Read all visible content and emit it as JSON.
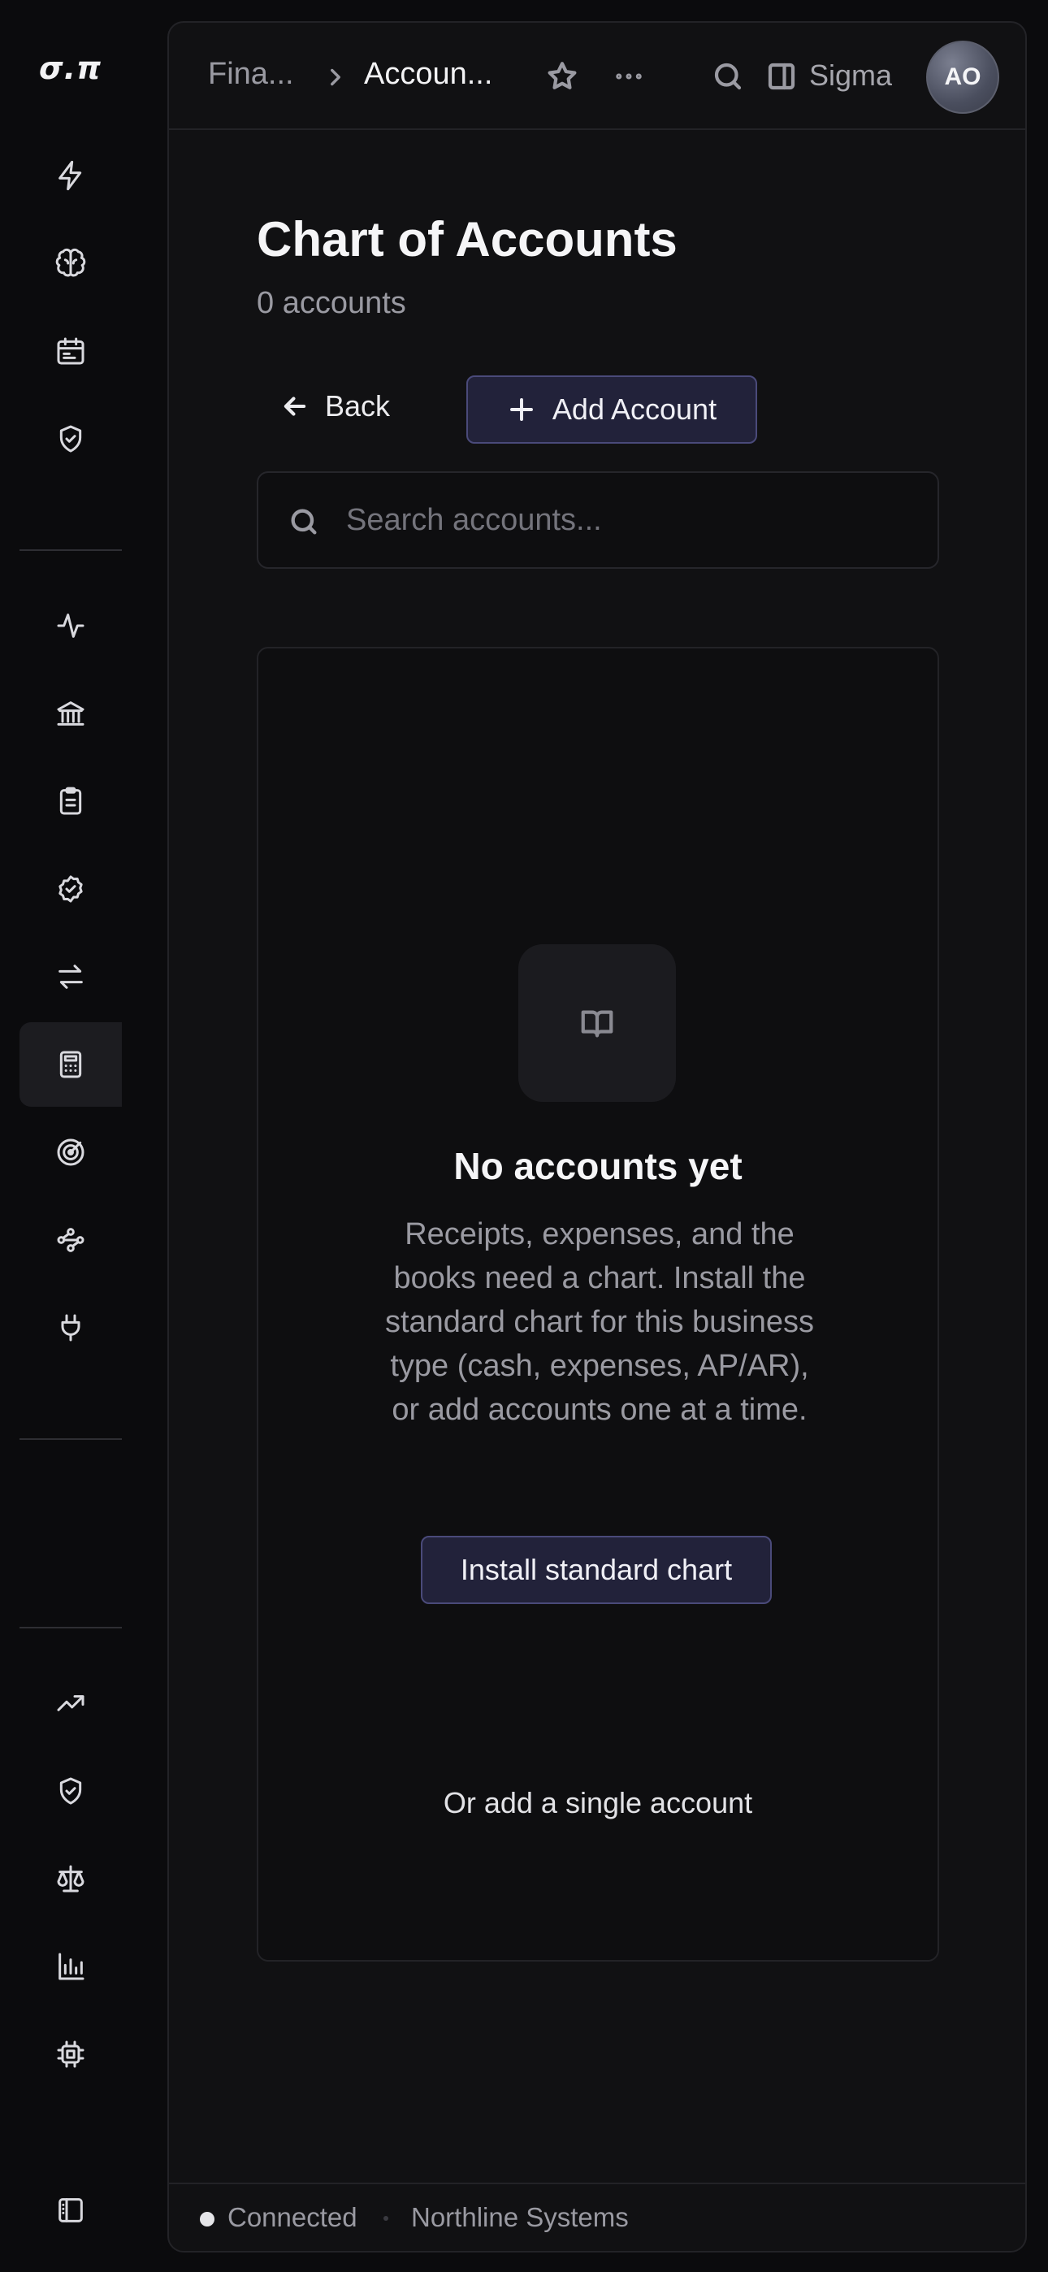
{
  "app": {
    "logo_text": "σ.π"
  },
  "sidebar": {
    "items": [
      {
        "icon": "lightning-icon",
        "active": false
      },
      {
        "icon": "brain-icon",
        "active": false
      },
      {
        "icon": "calendar-list-icon",
        "active": false
      },
      {
        "icon": "shield-check-icon",
        "active": false
      },
      {
        "icon": "activity-icon",
        "active": false
      },
      {
        "icon": "bank-icon",
        "active": false
      },
      {
        "icon": "clipboard-icon",
        "active": false
      },
      {
        "icon": "badge-check-icon",
        "active": false
      },
      {
        "icon": "arrows-swap-icon",
        "active": false
      },
      {
        "icon": "calculator-icon",
        "active": true
      },
      {
        "icon": "radar-target-icon",
        "active": false
      },
      {
        "icon": "workflow-icon",
        "active": false
      },
      {
        "icon": "plug-icon",
        "active": false
      },
      {
        "icon": "trending-up-icon",
        "active": false
      },
      {
        "icon": "shield-check-icon",
        "active": false
      },
      {
        "icon": "scale-icon",
        "active": false
      },
      {
        "icon": "bar-chart-icon",
        "active": false
      },
      {
        "icon": "cpu-chip-icon",
        "active": false
      },
      {
        "icon": "sidebar-panel-icon",
        "active": false
      }
    ]
  },
  "topbar": {
    "breadcrumb": [
      "Fina...",
      "Accoun..."
    ],
    "panel_label": "Sigma",
    "avatar_initials": "AO"
  },
  "page": {
    "title": "Chart of Accounts",
    "subtitle": "0 accounts",
    "back_label": "Back",
    "add_label": "Add Account"
  },
  "search": {
    "placeholder": "Search accounts...",
    "value": ""
  },
  "empty_state": {
    "title": "No accounts yet",
    "description": "Receipts, expenses, and the books need a chart. Install the standard chart for this business type (cash, expenses, AP/AR), or add accounts one at a time.",
    "install_label": "Install standard chart",
    "single_label": "Or add a single account"
  },
  "status": {
    "connection": "Connected",
    "organization": "Northline Systems"
  }
}
